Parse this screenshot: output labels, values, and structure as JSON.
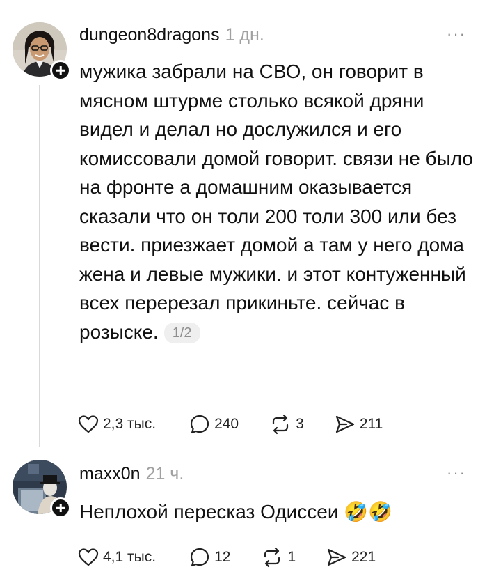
{
  "posts": [
    {
      "username": "dungeon8dragons",
      "timestamp": "1 дн.",
      "more_label": "···",
      "text": "мужика забрали на СВО, он говорит в мясном штурме столько всякой дряни видел и делал но дослужился и его комиссовали домой говорит. связи не было на фронте а домашним оказывается сказали что он толи 200 толи 300 или без вести. приезжает домой а там у него дома жена и левые мужики. и этот контуженный всех перерезал прикиньте. сейчас в розыске.",
      "pager": "1/2",
      "likes": "2,3 тыс.",
      "replies": "240",
      "reposts": "3",
      "shares": "211"
    },
    {
      "username": "maxx0n",
      "timestamp": "21 ч.",
      "more_label": "···",
      "text": "Неплохой пересказ Одиссеи",
      "emoji": "🤣🤣",
      "likes": "4,1 тыс.",
      "replies": "12",
      "reposts": "1",
      "shares": "221"
    }
  ],
  "icons": [
    "heart-icon",
    "comment-icon",
    "repost-icon",
    "share-icon",
    "plus-icon",
    "more-icon"
  ]
}
